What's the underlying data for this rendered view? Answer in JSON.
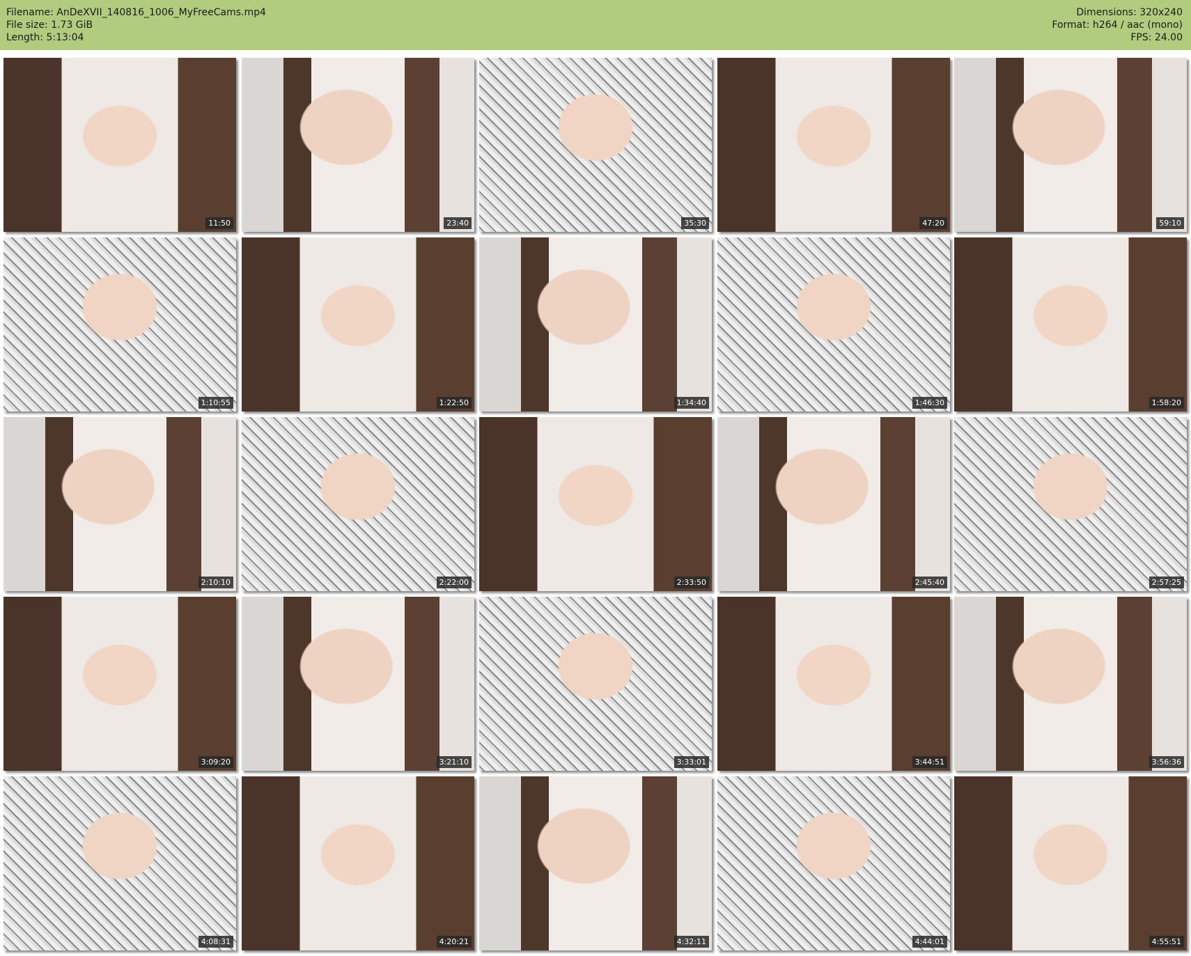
{
  "header": {
    "filename": "Filename: AnDeXVII_140816_1006_MyFreeCams.mp4",
    "file_size": "File size: 1.73 GiB",
    "length": "Length: 5:13:04",
    "dimensions": "Dimensions: 320x240",
    "format": "Format: h264 / aac (mono)",
    "fps": "FPS: 24.00"
  },
  "colors": {
    "header_bg": "#b1cc7f"
  },
  "thumbnails": [
    "11:50",
    "23:40",
    "35:30",
    "47:20",
    "59:10",
    "1:10:55",
    "1:22:50",
    "1:34:40",
    "1:46:30",
    "1:58:20",
    "2:10:10",
    "2:22:00",
    "2:33:50",
    "2:45:40",
    "2:57:25",
    "3:09:20",
    "3:21:10",
    "3:33:01",
    "3:44:51",
    "3:56:36",
    "4:08:31",
    "4:20:21",
    "4:32:11",
    "4:44:01",
    "4:55:51"
  ]
}
